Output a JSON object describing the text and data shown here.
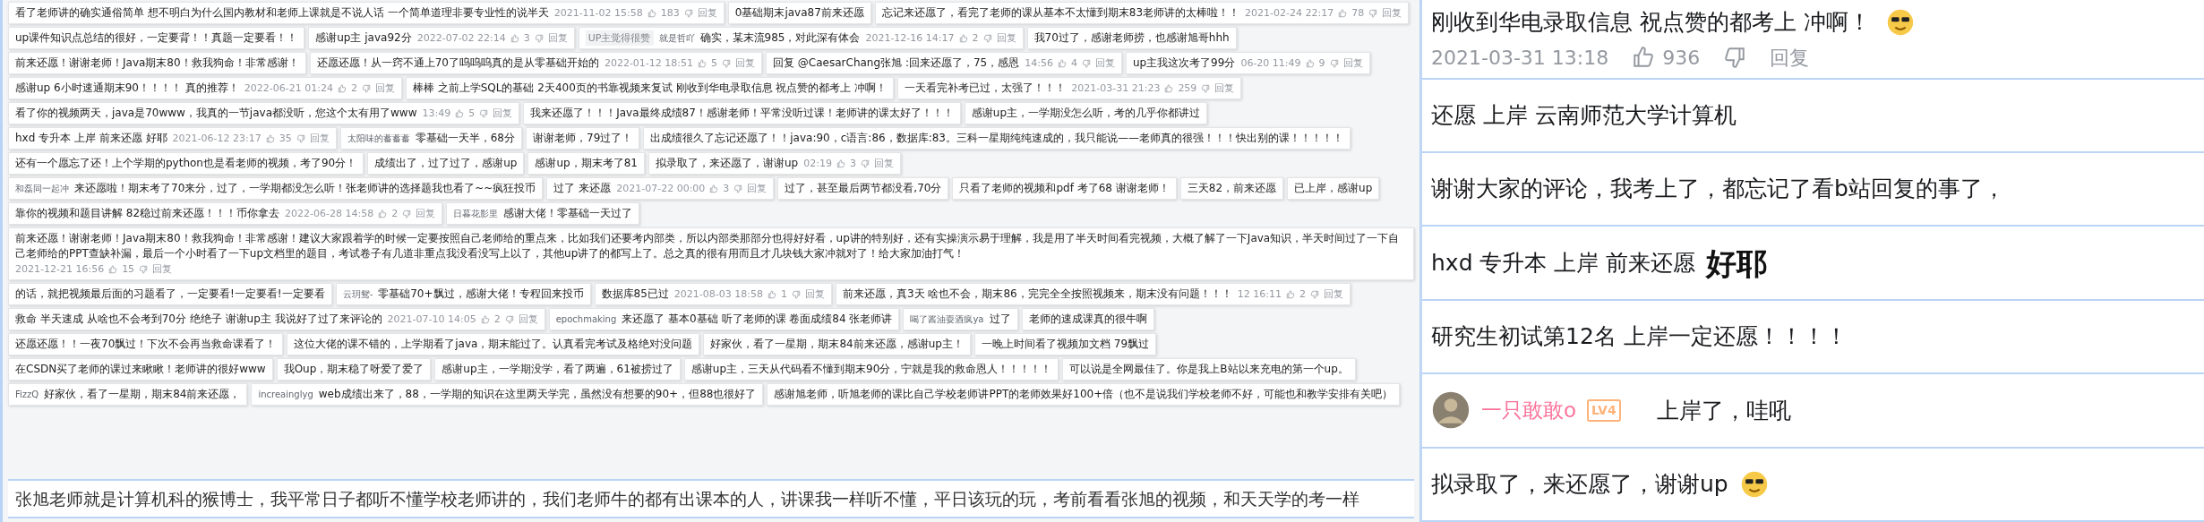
{
  "collage": {
    "cards": [
      {
        "text": "看了老师讲的确实通俗简单 想不明白为什么国内教材和老师上课就是不说人话 一个简单道理非要专业性的说半天",
        "date": "2021-11-02 15:58",
        "likes": "183",
        "reply": "回复"
      },
      {
        "text": "0基础期末java87前来还愿"
      },
      {
        "text": "忘记来还愿了，看完了老师的课从基本不太懂到期末83老师讲的太棒啦！！",
        "date": "2021-02-24 22:17",
        "likes": "78",
        "reply": "回复"
      },
      {
        "text": "up课件知识点总结的很好，一定要背！！真题一定要看！！"
      },
      {
        "text": "感谢up主 java92分",
        "date": "2022-07-02 22:14",
        "likes": "3",
        "reply": "回复"
      },
      {
        "tag": "UP主觉得很赞",
        "user": "就是哲吖",
        "text": "确实，某末流985，对此深有体会",
        "date": "2021-12-16 14:17",
        "likes": "2",
        "reply": "回复"
      },
      {
        "text": "我70过了，感谢老师捞，也感谢旭哥hhh"
      },
      {
        "text": "前来还愿！谢谢老师！Java期末80！救我狗命！非常感谢！"
      },
      {
        "text": "还愿还愿！从一窍不通上70了呜呜呜真的是从零基础开始的",
        "date": "2022-01-12 18:51",
        "likes": "5",
        "reply": "回复"
      },
      {
        "text": "回复 @CaesarChang张旭 :回来还愿了，75，感恩",
        "date": "14:56",
        "likes": "4",
        "reply": "回复"
      },
      {
        "text": "up主我这次考了99分",
        "date": "06-20 11:49",
        "likes": "9",
        "reply": "回复"
      },
      {
        "text": "感谢up 6小时速通期末90！！！！ 真的推荐！",
        "date": "2022-06-21 01:24",
        "likes": "2",
        "reply": "回复"
      },
      {
        "text": "棒棒 之前上学SQL的基础 2天400页的书靠视频来复试 刚收到华电录取信息 祝点赞的都考上 冲啊！"
      },
      {
        "text": "一天看完补考已过，太强了！！！",
        "date": "2021-03-31 21:23",
        "likes": "259",
        "reply": "回复"
      },
      {
        "text": "看了你的视频两天，java是70www，我真的一节java都没听，您这个太有用了www",
        "date": "13:49",
        "likes": "5",
        "reply": "回复"
      },
      {
        "text": "我来还愿了！！！Java最终成绩87！感谢老师！平常没听过课！老师讲的课太好了！！！"
      },
      {
        "text": "感谢up主，一学期没怎么听，考的几乎你都讲过"
      },
      {
        "text": "hxd 专升本 上岸 前来还愿 好耶",
        "date": "2021-06-12 23:17",
        "likes": "35",
        "reply": "回复"
      },
      {
        "user": "太阳味的蓄蓄蓄",
        "text": "零基础一天半，68分"
      },
      {
        "text": "谢谢老师，79过了！"
      },
      {
        "text": "出成绩很久了忘记还愿了！！java:90，c语言:86，数据库:83。三科一星期纯纯速成的，我只能说——老师真的很强！！！快出别的课！！！！！"
      },
      {
        "text": "还有一个愿忘了还！上个学期的python也是看老师的视频，考了90分！"
      },
      {
        "text": "成绩出了，过了过了，感谢up"
      },
      {
        "text": "感谢up，期末考了81"
      },
      {
        "text": "拟录取了，来还愿了，谢谢up",
        "date": "02:19",
        "likes": "3",
        "reply": "回复"
      },
      {
        "user": "和磊同一起冲",
        "text": "来还愿啦！期末考了70来分，过了，一学期都没怎么听！张老师讲的选择题我也看了~~疯狂投币"
      },
      {
        "text": "过了 来还愿",
        "date": "2021-07-22 00:00",
        "likes": "3",
        "reply": "回复"
      },
      {
        "text": "过了，甚至最后两节都没看,70分"
      },
      {
        "text": "只看了老师的视频和pdf 考了68 谢谢老师！"
      },
      {
        "text": "三天82，前来还愿"
      },
      {
        "text": "已上岸，感谢up"
      },
      {
        "text": "靠你的视频和题目讲解 82稳过前来还愿！！！币你拿去",
        "date": "2022-06-28 14:58",
        "likes": "2",
        "reply": "回复"
      },
      {
        "user": "日暮花影里",
        "text": "感谢大佬！零基础一天过了"
      },
      {
        "text": "前来还愿！谢谢老师！Java期末80！救我狗命！非常感谢！建议大家跟着学的时候一定要按照自己老师给的重点来，比如我们还要考内部类，所以内部类那部分也得好好看，up讲的特别好，还有实操演示易于理解，我是用了半天时间看完视频，大概了解了一下Java知识，半天时间过了一下自己老师给的PPT查缺补漏，最后一个小时看了一下up文档里的题目，考试卷子有几道非重点我没看没写上以了，其他up讲了的都写上了。总之真的很有用而且才几块钱大家冲就对了！给大家加油打气！",
        "date": "2021-12-21 16:56",
        "likes": "15",
        "reply": "回复"
      },
      {
        "text": "的话，就把视频最后面的习题看了，一定要看!一定要看!一定要看"
      },
      {
        "user": "云玥鸳-",
        "text": "零基础70+飘过，感谢大佬！专程回来投币"
      },
      {
        "text": "数据库85已过",
        "date": "2021-08-03 18:58",
        "likes": "1",
        "reply": "回复"
      },
      {
        "text": "前来还愿，真3天 啥也不会，期末86，完完全全按照视频来，期末没有问题！！！",
        "date": "12 16:11",
        "likes": "2",
        "reply": "回复"
      },
      {
        "text": "救命 半天速成 从啥也不会考到70分 绝绝子 谢谢up主 我说好了过了来评论的",
        "date": "2021-07-10 14:05",
        "likes": "2",
        "reply": "回复"
      },
      {
        "user": "epochmaking",
        "text": "来还愿了 基本0基础 听了老师的课 卷面成绩84 张老师讲"
      },
      {
        "user": "喝了酱油耍酒疯ya",
        "text": "过了"
      },
      {
        "text": "老师的速成课真的很牛啊"
      },
      {
        "text": "还愿还愿！！一夜70飘过！下次不会再当救命课看了！"
      },
      {
        "text": "这位大佬的课不错的，上学期看了java，期末能过了。认真看完考试及格绝对没问题"
      },
      {
        "text": "好家伙，看了一星期，期末84前来还愿，感谢up主！"
      },
      {
        "text": "一晚上时间看了视频加文档 79飘过"
      },
      {
        "text": "在CSDN买了老师的课过来瞅瞅！老师讲的很好www"
      },
      {
        "text": "我Oup，期末稳了呀爱了爱了"
      },
      {
        "text": "感谢up主，一学期没学，看了两遍，61被捞过了"
      },
      {
        "text": "感谢up主，三天从代码看不懂到期末90分，宁就是我的救命恩人！！！！！"
      },
      {
        "text": "可以说是全网最佳了。你是我上B站以来充电的第一个up。"
      },
      {
        "user": "FizzQ",
        "text": "好家伙，看了一星期，期末84前来还愿，"
      },
      {
        "user": "increainglyg",
        "text": "web成绩出来了，88，一学期的知识在这里两天学完，虽然没有想要的90+，但88也很好了"
      },
      {
        "text": "感谢旭老师，听旭老师的课比自己学校老师讲PPT的老师效果好100+倍（也不是说我们学校老师不好，可能也和教学安排有关吧）"
      }
    ],
    "banner": "张旭老师就是计算机科的猴博士，我平常日子都听不懂学校老师讲的，我们老师牛的都有出课本的人，讲课我一样听不懂，平日该玩的玩，考前看看张旭的视频，和天天学的考一样"
  },
  "comments": [
    {
      "kind": "text",
      "text": "刚收到华电录取信息 祝点赞的都考上 冲啊！",
      "emoji": true,
      "date": "2021-03-31 13:18",
      "likes": "936",
      "reply": "回复"
    },
    {
      "kind": "text",
      "text": "还愿 上岸 云南师范大学计算机"
    },
    {
      "kind": "text",
      "text": "谢谢大家的评论，我考上了，都忘记了看b站回复的事了，"
    },
    {
      "kind": "text",
      "text": "hxd  专升本 上岸 前来还愿",
      "sticker": "好耶"
    },
    {
      "kind": "text",
      "text": "研究生初试第12名  上岸一定还愿！！！！"
    },
    {
      "kind": "user",
      "user": "一只敢敢o",
      "level": "LV4",
      "text": "上岸了，哇吼"
    },
    {
      "kind": "text",
      "text": "拟录取了，来还愿了，谢谢up",
      "emoji": true
    }
  ]
}
